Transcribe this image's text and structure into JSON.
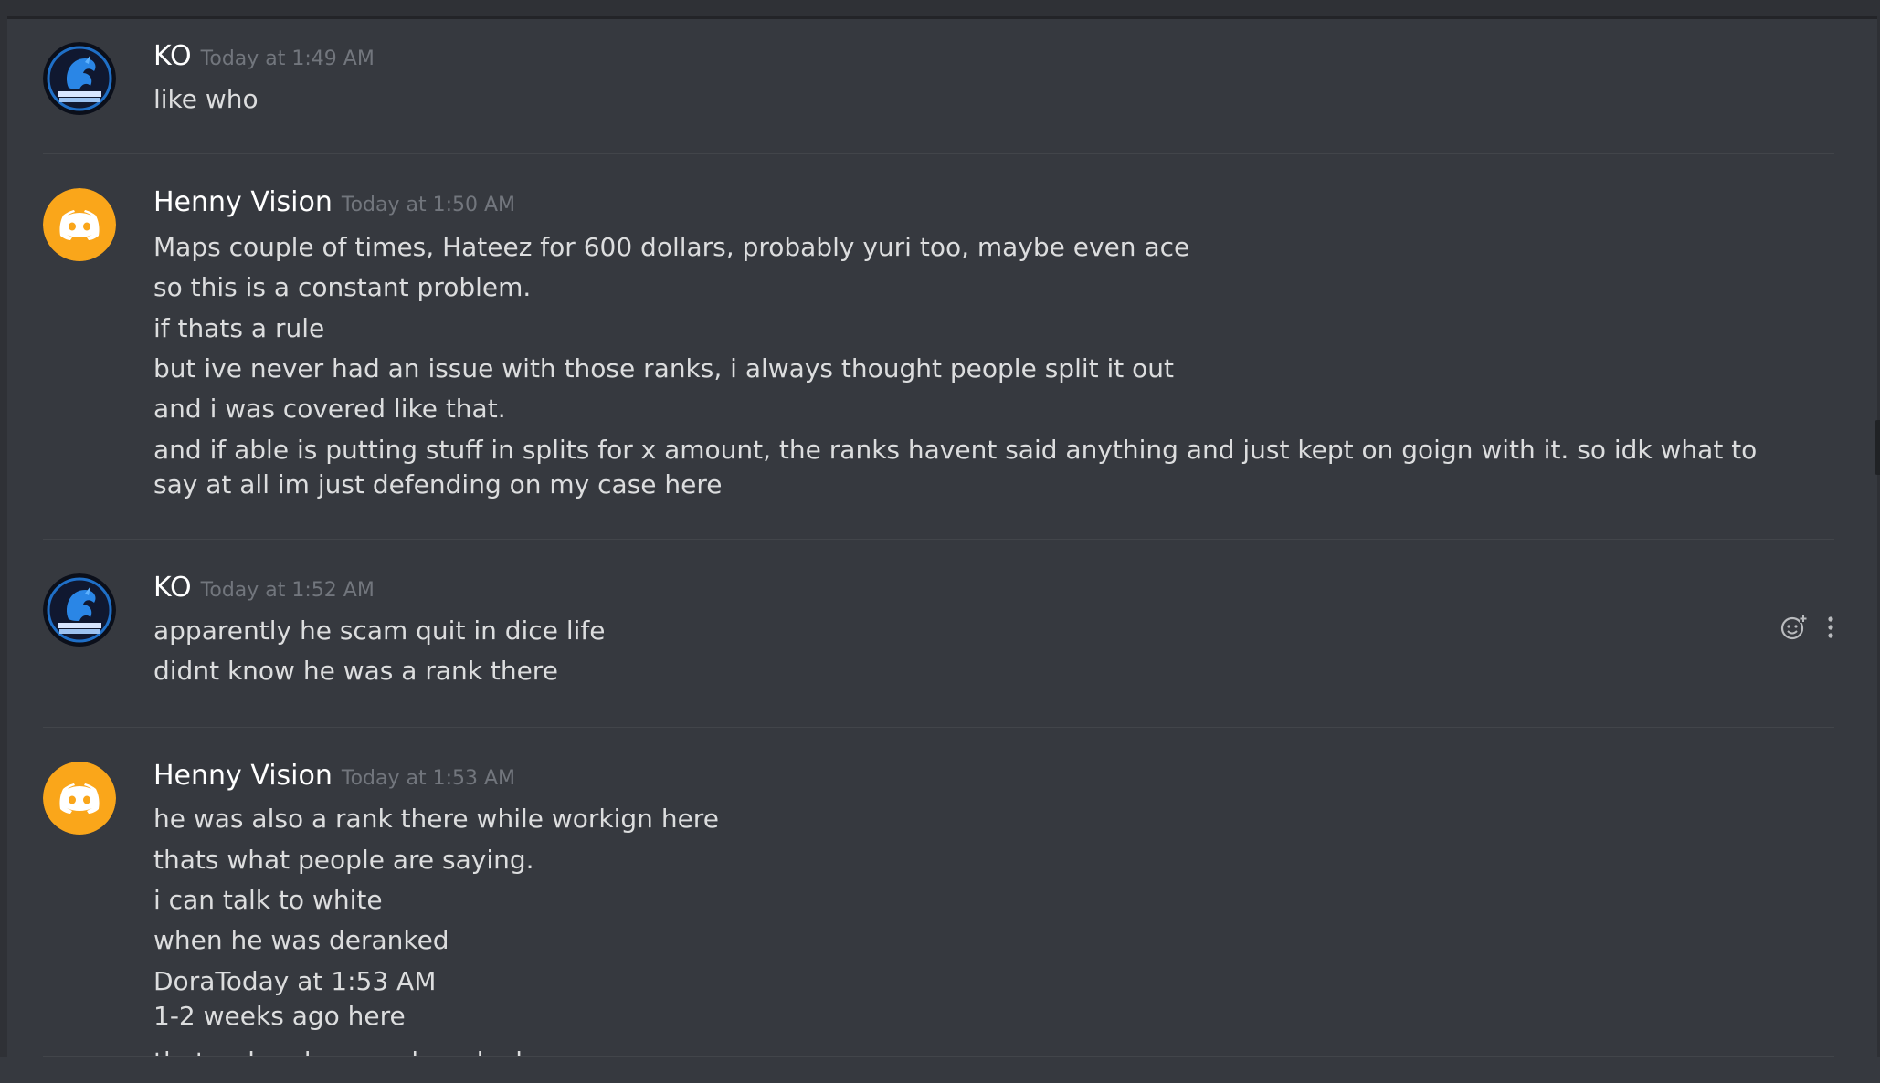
{
  "messages": [
    {
      "author": "KO",
      "timestamp": "Today at 1:49 AM",
      "avatar": "dragon-logo-avatar",
      "lines": [
        "like who"
      ]
    },
    {
      "author": "Henny Vision",
      "timestamp": "Today at 1:50 AM",
      "avatar": "discord-default-avatar",
      "lines": [
        "Maps couple of times, Hateez for 600 dollars, probably yuri too, maybe even ace",
        "so this is a constant problem.",
        "if thats a rule",
        "but ive never had an issue with those ranks, i always thought people split it out",
        "and i was covered like that.",
        "and if able is putting stuff in splits for x amount, the ranks havent said anything and just kept on goign with it. so idk what to say at all im just defending on my case here"
      ]
    },
    {
      "author": "KO",
      "timestamp": "Today at 1:52 AM",
      "avatar": "dragon-logo-avatar",
      "lines": [
        "apparently he scam quit in dice life",
        "didnt know he was a rank there"
      ]
    },
    {
      "author": "Henny Vision",
      "timestamp": "Today at 1:53 AM",
      "avatar": "discord-default-avatar",
      "lines": [
        "he was also a rank there while workign here",
        "thats what people are saying.",
        "i can talk to white",
        "when he was deranked",
        "DoraToday at 1:53 AM",
        "1-2 weeks ago here",
        "thats when he was deranked"
      ]
    }
  ],
  "colors": {
    "background": "#36393f",
    "username": "#ffffff",
    "timestamp": "#72767d",
    "message_text": "#dcddde",
    "discord_avatar_bg": "#faa61a",
    "divider": "#42454a"
  },
  "icons": {
    "add_reaction": "add-reaction-icon",
    "more_options": "more-options-icon"
  }
}
